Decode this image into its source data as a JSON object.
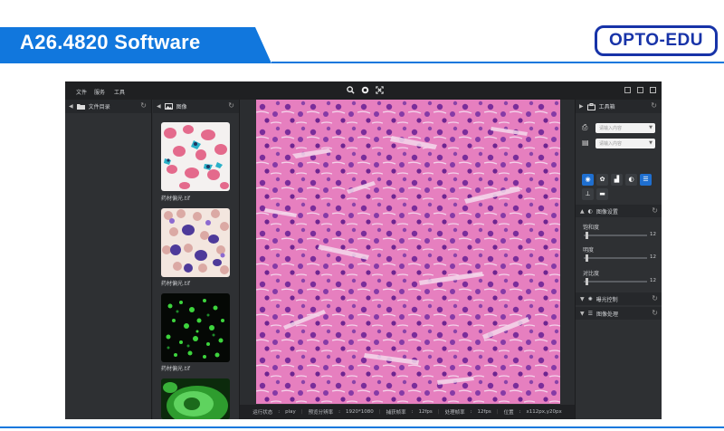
{
  "slide": {
    "title": "A26.4820 Software",
    "logo": "OPTO-EDU",
    "accent_color": "#1177dd",
    "logo_color": "#1733a8"
  },
  "app": {
    "menu": [
      "文件",
      "服务",
      "工具"
    ],
    "toolbar_icons": [
      "search-icon",
      "target-icon",
      "fit-icon"
    ],
    "window_controls": [
      "fullscreen-icon",
      "restore-icon",
      "close-icon"
    ]
  },
  "file_panel": {
    "title": "文件目录"
  },
  "image_panel": {
    "title": "图像",
    "thumbnails": [
      {
        "label": "药材偏光.tif",
        "kind": "blood-smear-pink"
      },
      {
        "label": "药材偏光.tif",
        "kind": "blood-smear-purple"
      },
      {
        "label": "药材偏光.tif",
        "kind": "fluorescence-green-dots"
      },
      {
        "label": "",
        "kind": "fluorescence-green-cells"
      }
    ]
  },
  "viewer": {
    "image_kind": "liver-tissue-he-stain"
  },
  "status": {
    "run_state_label": "运行状态",
    "run_state": "play",
    "preview_res_label": "预览分辨率",
    "preview_res": "1920*1080",
    "capture_fps_label": "捕获帧率",
    "capture_fps": "12fps",
    "process_fps_label": "处理帧率",
    "process_fps": "12fps",
    "position_label": "位置",
    "position": "x112px,y20px"
  },
  "toolbox": {
    "title": "工具箱",
    "input1_placeholder": "请输入内容",
    "input2_placeholder": "请输入内容",
    "image_settings": {
      "title": "图像设置",
      "saturation_label": "饱和度",
      "saturation": 12,
      "brightness_label": "明度",
      "brightness": 12,
      "contrast_label": "对比度",
      "contrast": 12
    },
    "exposure_title": "曝光控制",
    "processing_title": "图像处理"
  }
}
